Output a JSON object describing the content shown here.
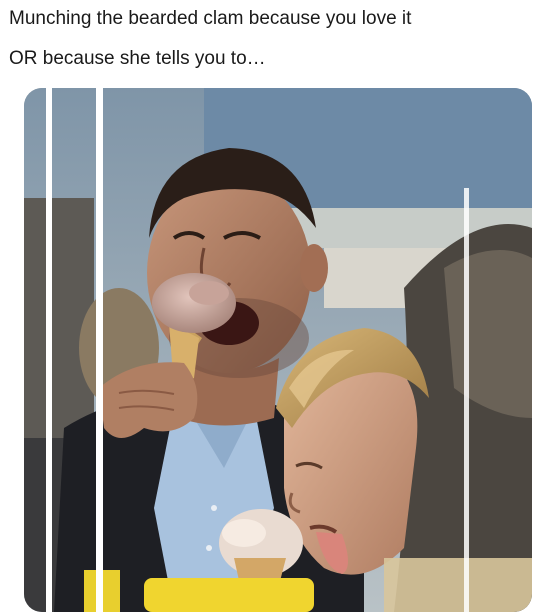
{
  "caption": {
    "line1": "Munching the bearded clam because you love it",
    "line2": "OR because she tells you to…"
  },
  "photo": {
    "icon": "meme-photo-two-men-ice-cream"
  }
}
